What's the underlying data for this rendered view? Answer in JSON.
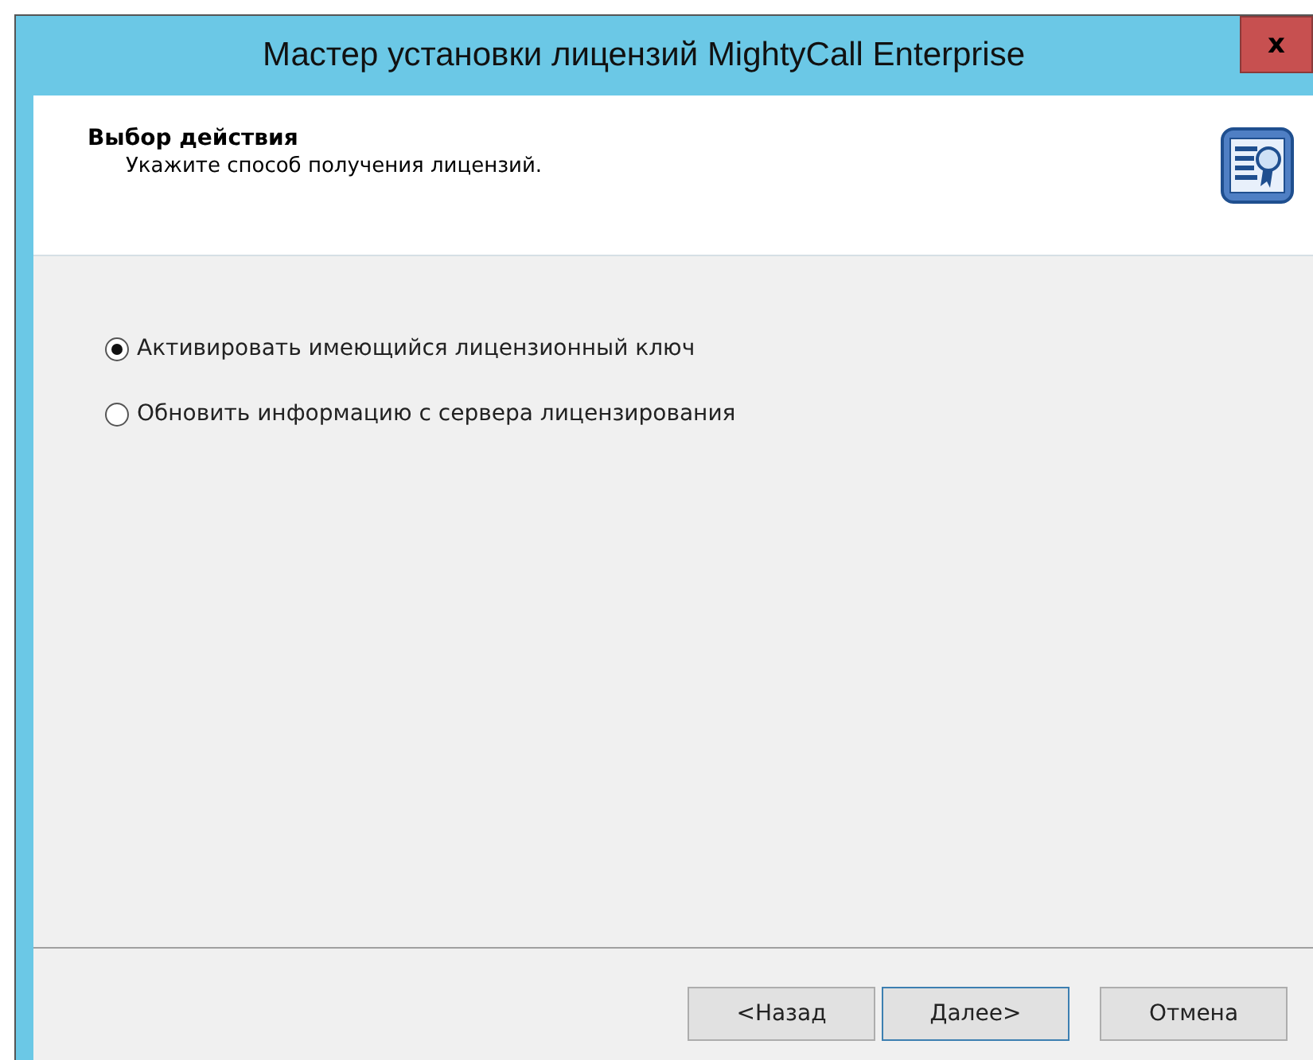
{
  "window": {
    "title": "Мастер установки лицензий MightyCall Enterprise",
    "close": "x"
  },
  "header": {
    "title": "Выбор действия",
    "subtitle": "Укажите способ получения лицензий."
  },
  "options": [
    {
      "label": "Активировать имеющийся лицензионный ключ",
      "selected": true
    },
    {
      "label": "Обновить информацию с сервера лицензирования",
      "selected": false
    }
  ],
  "buttons": [
    {
      "label": "<Назад",
      "focused": false
    },
    {
      "label": "Далее>",
      "focused": true
    },
    {
      "label": "Отмена",
      "focused": false
    }
  ]
}
